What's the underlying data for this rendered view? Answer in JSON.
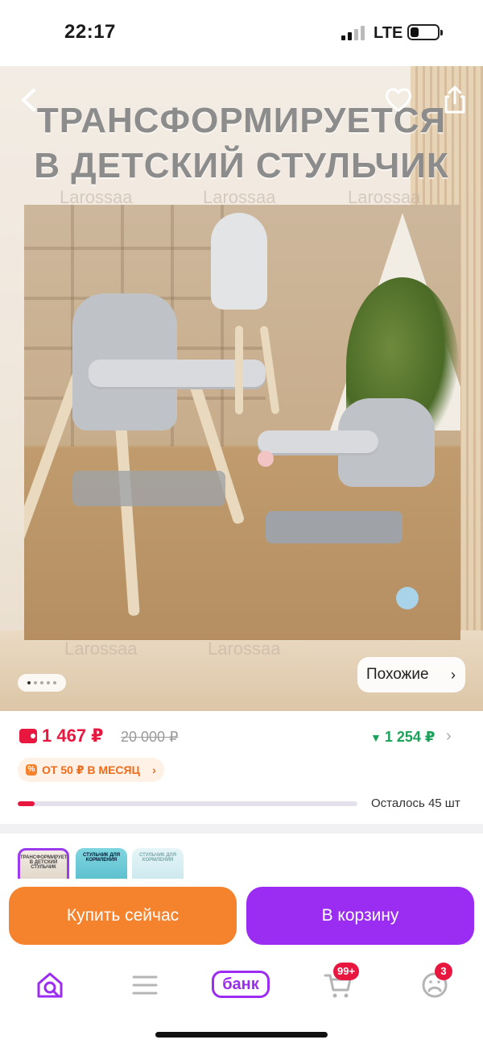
{
  "status_bar": {
    "time": "22:17",
    "network": "LTE"
  },
  "product_image": {
    "headline_line1": "ТРАНСФОРМИРУЕТСЯ",
    "headline_line2": "В ДЕТСКИЙ СТУЛЬЧИК",
    "watermark": "Larossaa",
    "similar_label": "Похожие",
    "slide_count": 5,
    "current_slide": 1
  },
  "pricing": {
    "price": "1 467 ₽",
    "old_price": "20 000 ₽",
    "wallet_price": "1 254 ₽",
    "installment": "ОТ 50 ₽ В МЕСЯЦ",
    "stock_remaining_fraction": 0.05,
    "stock_text": "Осталось 45 шт"
  },
  "variants": [
    {
      "label": "ТРАНСФОРМИРУЕТСЯ В ДЕТСКИЙ СТУЛЬЧИК",
      "selected": true
    },
    {
      "label": "СТУЛЬЧИК ДЛЯ КОРМЛЕНИЯ",
      "selected": false
    },
    {
      "label": "СТУЛЬЧИК ДЛЯ КОРМЛЕНИЯ",
      "selected": false
    }
  ],
  "actions": {
    "buy_now": "Купить сейчас",
    "add_to_cart": "В корзину"
  },
  "tabbar": {
    "bank_label": "банк",
    "cart_badge": "99+",
    "profile_badge": "3"
  },
  "colors": {
    "accent_purple": "#9b2cf1",
    "accent_orange": "#f5822d",
    "price_red": "#e8173f",
    "green": "#1aa35a"
  }
}
